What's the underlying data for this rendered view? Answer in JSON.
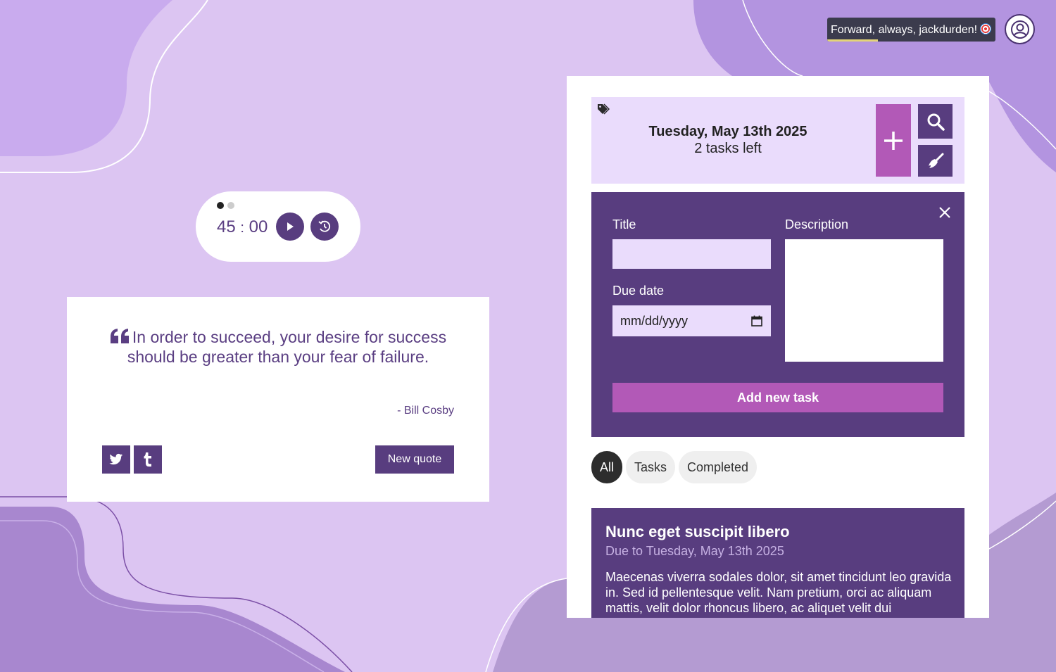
{
  "greeting": {
    "text": "Forward, always, jackdurden!",
    "icon": "target-icon",
    "progress_fraction": 0.3
  },
  "user": {
    "icon": "user-icon"
  },
  "timer": {
    "slides": 2,
    "active_slide": 1,
    "minutes": "45",
    "separator": ":",
    "seconds": "00",
    "play_icon": "play-icon",
    "reset_icon": "reset-timer-icon"
  },
  "quote": {
    "text": "In order to succeed, your desire for success should be greater than your fear of failure.",
    "author": "- Bill Cosby",
    "new_quote_label": "New quote",
    "share_icons": [
      "twitter-icon",
      "tumblr-icon"
    ]
  },
  "todo": {
    "date": "Tuesday, May 13th 2025",
    "tasks_left": "2 tasks left",
    "form": {
      "title_label": "Title",
      "title_value": "",
      "due_label": "Due date",
      "due_placeholder": "mm/dd/yyyy",
      "description_label": "Description",
      "description_value": "",
      "submit_label": "Add new task"
    },
    "filters": [
      "All",
      "Tasks",
      "Completed"
    ],
    "active_filter": "All",
    "tasks": [
      {
        "title": "Nunc eget suscipit libero",
        "due": "Due to Tuesday, May 13th 2025",
        "description": "Maecenas viverra sodales dolor, sit amet tincidunt leo gravida in. Sed id pellentesque velit. Nam pretium, orci ac aliquam mattis, velit dolor rhoncus libero, ac aliquet velit dui"
      }
    ]
  },
  "colors": {
    "background": "#dcc5f2",
    "primary": "#583d7f",
    "accent": "#b259b7",
    "light": "#eadcfc"
  }
}
